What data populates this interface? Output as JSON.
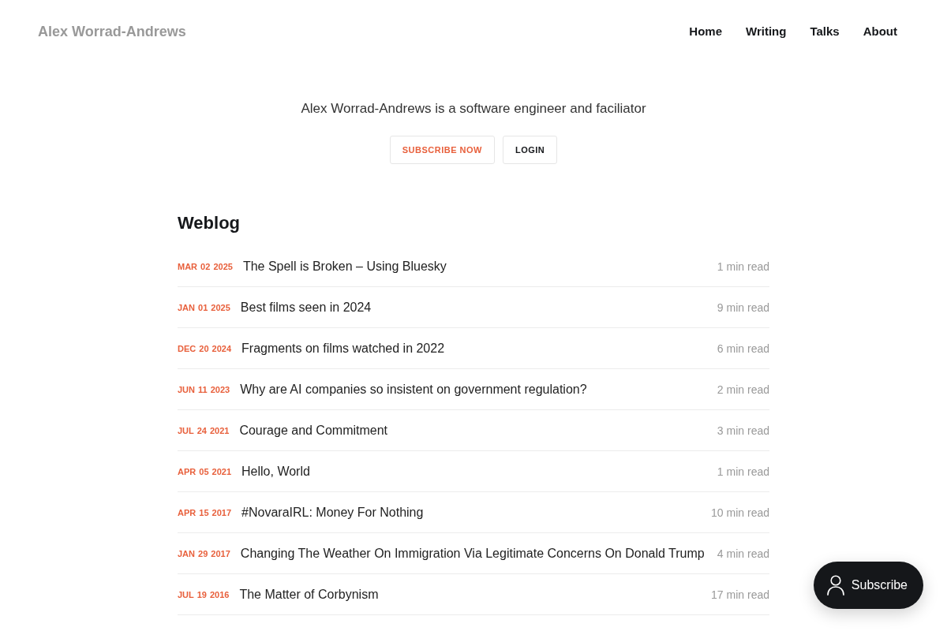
{
  "header": {
    "site_title": "Alex Worrad-Andrews",
    "nav": [
      "Home",
      "Writing",
      "Talks",
      "About"
    ]
  },
  "hero": {
    "description": "Alex Worrad-Andrews is a software engineer and faciliator",
    "buttons": [
      {
        "label": "SUBSCRIBE NOW",
        "kind": "primary"
      },
      {
        "label": "LOGIN",
        "kind": "secondary"
      }
    ]
  },
  "weblog": {
    "heading": "Weblog",
    "posts": [
      {
        "date": "MAR 02 2025",
        "title": "The Spell is Broken – Using Bluesky",
        "read_time": "1 min read"
      },
      {
        "date": "JAN 01 2025",
        "title": "Best films seen in 2024",
        "read_time": "9 min read"
      },
      {
        "date": "DEC 20 2024",
        "title": "Fragments on films watched in 2022",
        "read_time": "6 min read"
      },
      {
        "date": "JUN 11 2023",
        "title": "Why are AI companies so insistent on government regulation?",
        "read_time": "2 min read"
      },
      {
        "date": "JUL 24 2021",
        "title": "Courage and Commitment",
        "read_time": "3 min read"
      },
      {
        "date": "APR 05 2021",
        "title": "Hello, World",
        "read_time": "1 min read"
      },
      {
        "date": "APR 15 2017",
        "title": "#NovaraIRL: Money For Nothing",
        "read_time": "10 min read"
      },
      {
        "date": "JAN 29 2017",
        "title": "Changing The Weather On Immigration Via Legitimate Concerns On Donald Trump",
        "read_time": "4 min read"
      },
      {
        "date": "JUL 19 2016",
        "title": "The Matter of Corbynism",
        "read_time": "17 min read"
      }
    ]
  },
  "floating_subscribe": {
    "label": "Subscribe"
  }
}
